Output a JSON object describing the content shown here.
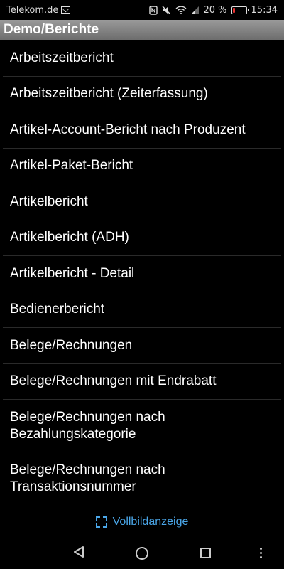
{
  "status_bar": {
    "carrier": "Telekom.de",
    "battery_percent": "20 %",
    "battery_level": 0.2,
    "time": "15:34",
    "icons": [
      "mail-icon",
      "nfc-icon",
      "mute-icon",
      "wifi-icon",
      "signal-icon",
      "battery-icon"
    ]
  },
  "title_bar": {
    "title": "Demo/Berichte"
  },
  "reports": [
    {
      "label": "Arbeitszeitbericht"
    },
    {
      "label": "Arbeitszeitbericht (Zeiterfassung)"
    },
    {
      "label": "Artikel-Account-Bericht nach Produzent"
    },
    {
      "label": "Artikel-Paket-Bericht"
    },
    {
      "label": "Artikelbericht"
    },
    {
      "label": "Artikelbericht (ADH)"
    },
    {
      "label": "Artikelbericht - Detail"
    },
    {
      "label": "Bedienerbericht"
    },
    {
      "label": "Belege/Rechnungen"
    },
    {
      "label": "Belege/Rechnungen mit Endrabatt"
    },
    {
      "label": "Belege/Rechnungen nach Bezahlungskategorie"
    },
    {
      "label": "Belege/Rechnungen nach Transaktionsnummer"
    }
  ],
  "fullscreen": {
    "label": "Vollbildanzeige",
    "color": "#4aa6e8"
  },
  "nav_bar": {
    "icons": [
      "back-icon",
      "home-icon",
      "recents-icon",
      "more-icon"
    ]
  }
}
